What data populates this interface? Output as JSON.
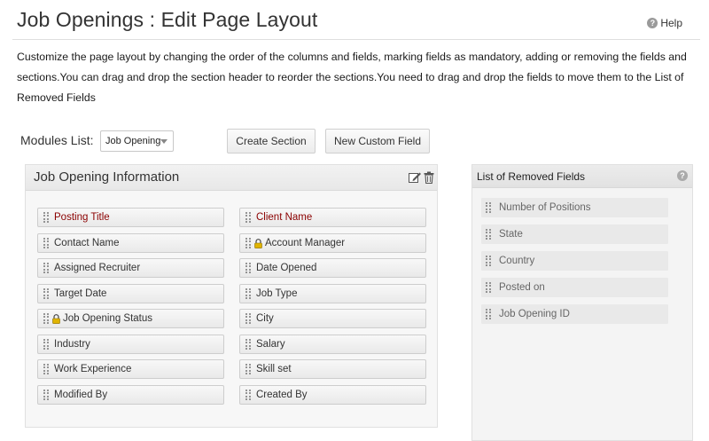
{
  "header": {
    "title": "Job Openings : Edit Page Layout",
    "help_label": "Help"
  },
  "description": "Customize the page layout by changing the order of the columns and fields, marking fields as mandatory, adding or removing the fields and sections.You can drag and drop the section header to reorder the sections.You need to drag and drop the fields to move them to the List of Removed Fields",
  "toolbar": {
    "modules_label": "Modules List:",
    "module_selected": "Job Opening",
    "create_section_label": "Create Section",
    "new_custom_field_label": "New Custom Field"
  },
  "section": {
    "title": "Job Opening Information",
    "left_fields": [
      {
        "label": "Posting Title",
        "mandatory": true,
        "locked": false
      },
      {
        "label": "Contact Name",
        "mandatory": false,
        "locked": false
      },
      {
        "label": "Assigned Recruiter",
        "mandatory": false,
        "locked": false
      },
      {
        "label": "Target Date",
        "mandatory": false,
        "locked": false
      },
      {
        "label": "Job Opening Status",
        "mandatory": false,
        "locked": true
      },
      {
        "label": "Industry",
        "mandatory": false,
        "locked": false
      },
      {
        "label": "Work Experience",
        "mandatory": false,
        "locked": false
      },
      {
        "label": "Modified By",
        "mandatory": false,
        "locked": false
      }
    ],
    "right_fields": [
      {
        "label": "Client Name",
        "mandatory": true,
        "locked": false
      },
      {
        "label": "Account Manager",
        "mandatory": false,
        "locked": true
      },
      {
        "label": "Date Opened",
        "mandatory": false,
        "locked": false
      },
      {
        "label": "Job Type",
        "mandatory": false,
        "locked": false
      },
      {
        "label": "City",
        "mandatory": false,
        "locked": false
      },
      {
        "label": "Salary",
        "mandatory": false,
        "locked": false
      },
      {
        "label": "Skill set",
        "mandatory": false,
        "locked": false
      },
      {
        "label": "Created By",
        "mandatory": false,
        "locked": false
      }
    ]
  },
  "removed": {
    "title": "List of Removed Fields",
    "items": [
      "Number of Positions",
      "State",
      "Country",
      "Posted on",
      "Job Opening ID"
    ]
  },
  "colors": {
    "mandatory_text": "#8b0000",
    "lock_icon": "#e0b400"
  },
  "icons": {
    "help": "help-circle-icon",
    "edit": "edit-icon",
    "delete": "trash-icon",
    "drag": "drag-handle-icon",
    "lock": "lock-icon"
  }
}
